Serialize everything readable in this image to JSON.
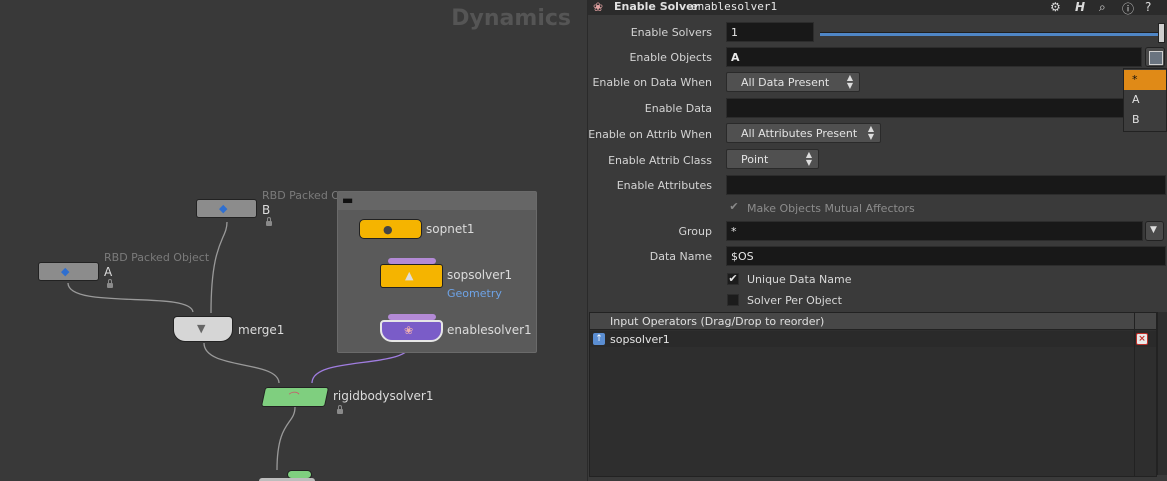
{
  "network": {
    "context_title": "Dynamics",
    "nodes": {
      "rbd_b": {
        "type_label": "RBD Packed Object",
        "name": "B"
      },
      "rbd_a": {
        "type_label": "RBD Packed Object",
        "name": "A"
      },
      "merge": {
        "name": "merge1"
      },
      "rigidbodysolver": {
        "name": "rigidbodysolver1"
      },
      "sopnet": {
        "name": "sopnet1"
      },
      "sopsolver": {
        "name": "sopsolver1",
        "type_label": "Geometry"
      },
      "enablesolver": {
        "name": "enablesolver1"
      }
    },
    "colors": {
      "rbd": "#8c8c8c",
      "merge": "#d6d6d6",
      "solver": "#7fcf7f",
      "sop": "#f5b400",
      "enable": "#7a5cc8"
    }
  },
  "params": {
    "header": {
      "node_kind": "Enable Solver",
      "node_name": "enablesolver1",
      "icons": [
        "gear-icon",
        "help-h-icon",
        "search-icon",
        "info-icon",
        "help-icon"
      ]
    },
    "enable_solvers": {
      "label": "Enable Solvers",
      "value": "1"
    },
    "enable_objects": {
      "label": "Enable Objects",
      "value": "A"
    },
    "enable_on_data_when": {
      "label": "Enable on Data When",
      "value": "All Data Present"
    },
    "enable_data": {
      "label": "Enable Data",
      "value": ""
    },
    "enable_on_attrib_when": {
      "label": "Enable on Attrib When",
      "value": "All Attributes Present"
    },
    "enable_attrib_class": {
      "label": "Enable Attrib Class",
      "value": "Point"
    },
    "enable_attributes": {
      "label": "Enable Attributes",
      "value": ""
    },
    "make_objects_mutual_affectors": {
      "label": "Make Objects Mutual Affectors",
      "checked": true,
      "enabled": false
    },
    "group": {
      "label": "Group",
      "value": "*"
    },
    "data_name": {
      "label": "Data Name",
      "value": "$OS"
    },
    "unique_data_name": {
      "label": "Unique Data Name",
      "checked": true
    },
    "solver_per_object": {
      "label": "Solver Per Object",
      "checked": false
    },
    "objects_popup": {
      "items": [
        "*",
        "A",
        "B"
      ],
      "selected": "*"
    },
    "input_operators": {
      "header": "Input Operators (Drag/Drop to reorder)",
      "items": [
        {
          "name": "sopsolver1"
        }
      ]
    }
  }
}
